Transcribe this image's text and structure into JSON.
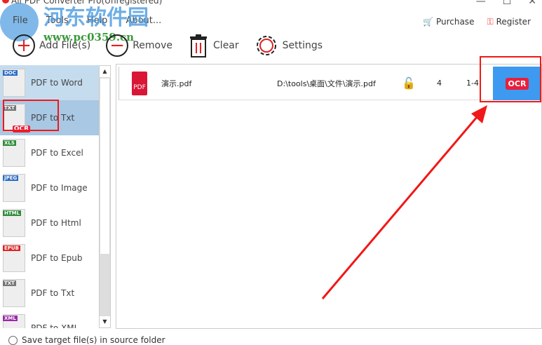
{
  "window": {
    "title": "All PDF Converter Pro(Unregistered)",
    "controls": [
      "—",
      "☐",
      "✕"
    ]
  },
  "watermark": {
    "cn": "河东软件园",
    "url": "www.pc0359.cn"
  },
  "menu": [
    "File",
    "Tools",
    "Help",
    "About..."
  ],
  "toplinks": {
    "purchase": "Purchase",
    "register": "Register"
  },
  "toolbar": {
    "add": "Add File(s)",
    "remove": "Remove",
    "clear": "Clear",
    "settings": "Settings"
  },
  "sidebar": [
    {
      "label": "PDF to Word",
      "tag": "DOC",
      "color": "#2b6cc4"
    },
    {
      "label": "PDF to Txt",
      "tag": "TXT",
      "color": "#777",
      "ocr": "OCR"
    },
    {
      "label": "PDF to Excel",
      "tag": "XLS",
      "color": "#2e8b3a"
    },
    {
      "label": "PDF to Image",
      "tag": "JPEG",
      "color": "#2b6cc4"
    },
    {
      "label": "PDF to Html",
      "tag": "HTML",
      "color": "#2e8b3a"
    },
    {
      "label": "PDF to Epub",
      "tag": "EPUB",
      "color": "#d22"
    },
    {
      "label": "PDF to Txt",
      "tag": "TXT",
      "color": "#777"
    },
    {
      "label": "PDF to XML",
      "tag": "XML",
      "color": "#9b2aa8"
    }
  ],
  "file": {
    "icon": "PDF",
    "name": "演示.pdf",
    "path": "D:\\tools\\桌面\\文件\\演示.pdf",
    "pages": "4",
    "range": "1-4",
    "ocr": "OCR"
  },
  "bottom": {
    "option": "Save target file(s) in source folder"
  }
}
